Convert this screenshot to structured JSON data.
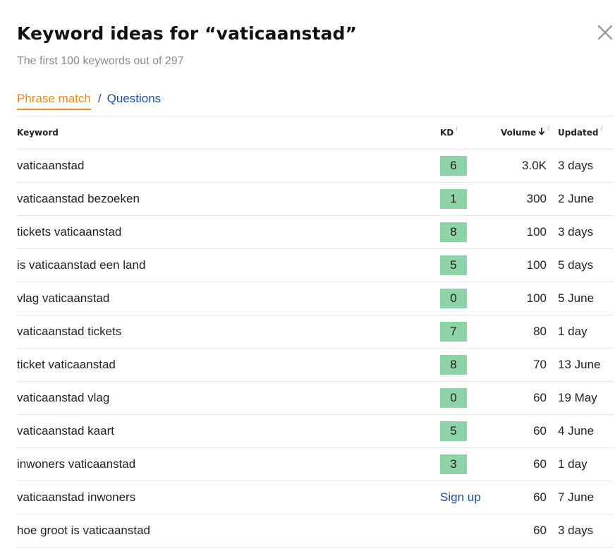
{
  "dialog": {
    "title": "Keyword ideas for “vaticaanstad”",
    "subtitle": "The first 100 keywords out of 297",
    "close_icon": "close-icon"
  },
  "tabs": {
    "active": "Phrase match",
    "separator": "/",
    "other": "Questions"
  },
  "table": {
    "headers": {
      "keyword": "Keyword",
      "kd": "KD",
      "volume": "Volume",
      "updated": "Updated",
      "info_glyph": "i"
    },
    "sort": {
      "column": "volume",
      "direction": "descending",
      "icon": "arrow-down-icon"
    },
    "kd_color": "#8fd3a9",
    "rows": [
      {
        "keyword": "vaticaanstad",
        "kd": "6",
        "volume": "3.0K",
        "updated": "3 days"
      },
      {
        "keyword": "vaticaanstad bezoeken",
        "kd": "1",
        "volume": "300",
        "updated": "2 June"
      },
      {
        "keyword": "tickets vaticaanstad",
        "kd": "8",
        "volume": "100",
        "updated": "3 days"
      },
      {
        "keyword": "is vaticaanstad een land",
        "kd": "5",
        "volume": "100",
        "updated": "5 days"
      },
      {
        "keyword": "vlag vaticaanstad",
        "kd": "0",
        "volume": "100",
        "updated": "5 June"
      },
      {
        "keyword": "vaticaanstad tickets",
        "kd": "7",
        "volume": "80",
        "updated": "1 day"
      },
      {
        "keyword": "ticket vaticaanstad",
        "kd": "8",
        "volume": "70",
        "updated": "13 June"
      },
      {
        "keyword": "vaticaanstad vlag",
        "kd": "0",
        "volume": "60",
        "updated": "19 May"
      },
      {
        "keyword": "vaticaanstad kaart",
        "kd": "5",
        "volume": "60",
        "updated": "4 June"
      },
      {
        "keyword": "inwoners vaticaanstad",
        "kd": "3",
        "volume": "60",
        "updated": "1 day"
      },
      {
        "keyword": "vaticaanstad inwoners",
        "kd_signup": "Sign up",
        "volume": "60",
        "updated": "7 June"
      },
      {
        "keyword": "hoe groot is vaticaanstad",
        "kd": "",
        "volume": "60",
        "updated": "3 days"
      }
    ]
  },
  "colors": {
    "accent_orange": "#f0861f",
    "link_blue": "#1d4ea8",
    "kd_green": "#8fd3a9"
  }
}
